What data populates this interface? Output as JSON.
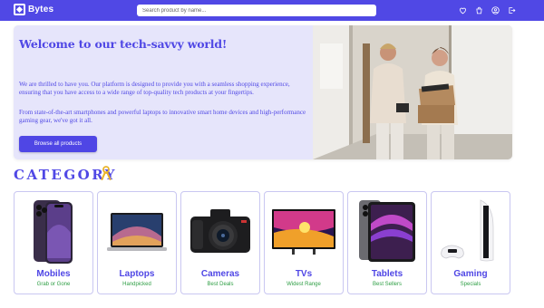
{
  "brand": {
    "name": "Bytes"
  },
  "search": {
    "placeholder": "Search product by name..."
  },
  "header_icons": [
    "heart-icon",
    "cart-icon",
    "user-icon",
    "logout-icon"
  ],
  "hero": {
    "title": "Welcome to our tech-savvy world!",
    "paragraph1": "We are thrilled to have you. Our platform is designed to provide you with a seamless shopping experience, ensuring that you have access to a wide range of top-quality tech products at your fingertips.",
    "paragraph2": "From state-of-the-art smartphones and powerful laptops to innovative smart home devices and high-performance gaming gear, we've got it all.",
    "button_label": "Browse all products"
  },
  "category": {
    "title": "CATEGORY",
    "items": [
      {
        "name": "Mobiles",
        "subtitle": "Grab or Gone"
      },
      {
        "name": "Laptops",
        "subtitle": "Handpicked"
      },
      {
        "name": "Cameras",
        "subtitle": "Best Deals"
      },
      {
        "name": "TVs",
        "subtitle": "Widest Range"
      },
      {
        "name": "Tablets",
        "subtitle": "Best Sellers"
      },
      {
        "name": "Gaming",
        "subtitle": "Specials"
      }
    ]
  },
  "colors": {
    "brand": "#5048e5",
    "hero_bg": "#e6e5fb",
    "accent_green": "#2e9e44",
    "card_border": "#c9c7f1"
  }
}
